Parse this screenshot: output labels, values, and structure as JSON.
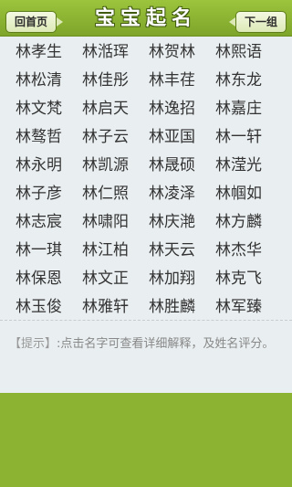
{
  "header": {
    "home_label": "回首页",
    "title": "宝宝起名",
    "next_label": "下一组"
  },
  "names": [
    "林孝生",
    "林湉珲",
    "林贺林",
    "林熙语",
    "林松清",
    "林佳彤",
    "林丰荏",
    "林东龙",
    "林文梵",
    "林启天",
    "林逸招",
    "林嘉庄",
    "林骜哲",
    "林子云",
    "林亚国",
    "林一轩",
    "林永明",
    "林凯源",
    "林晟硕",
    "林滢光",
    "林子彦",
    "林仁照",
    "林凌泽",
    "林帼如",
    "林志宸",
    "林啸阳",
    "林庆滟",
    "林方麟",
    "林一琪",
    "林江柏",
    "林天云",
    "林杰华",
    "林保恩",
    "林文正",
    "林加翔",
    "林克飞",
    "林玉俊",
    "林雅轩",
    "林胜麟",
    "林军臻"
  ],
  "tip": {
    "label": "【提示】",
    "text": ":点击名字可查看详细解释，及姓名评分。"
  }
}
